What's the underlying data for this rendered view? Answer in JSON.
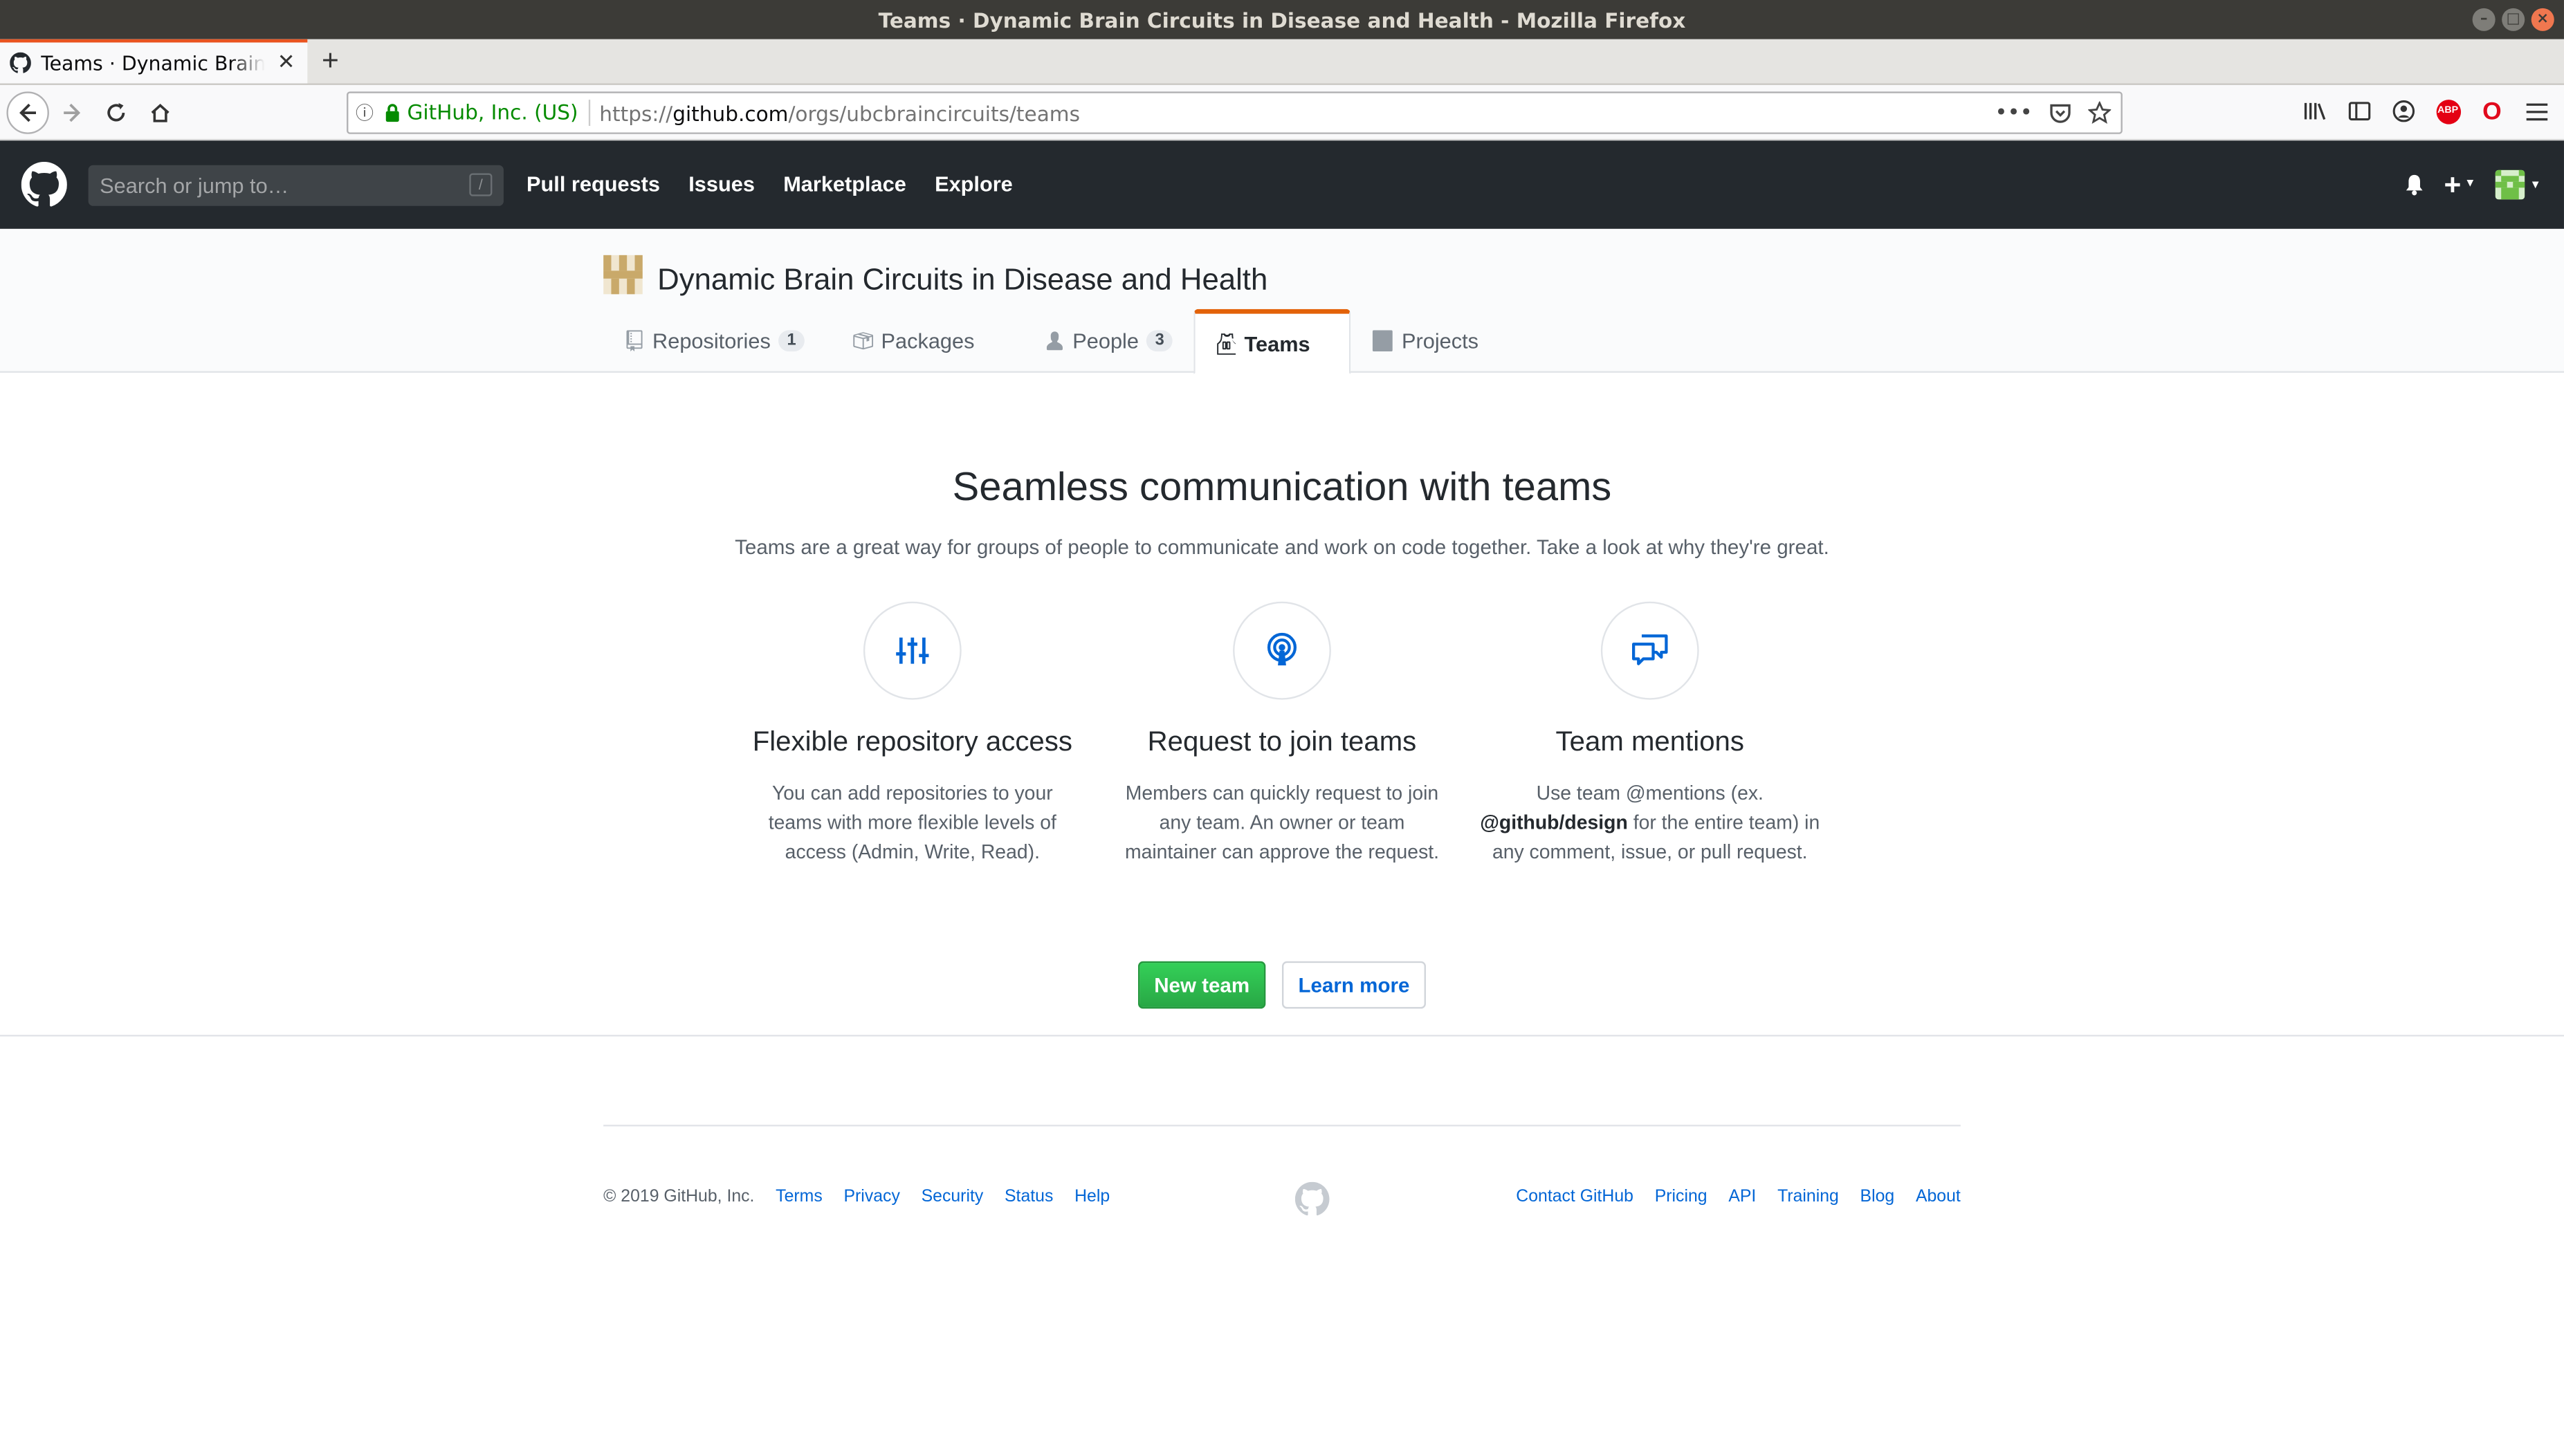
{
  "window": {
    "title": "Teams · Dynamic Brain Circuits in Disease and Health - Mozilla Firefox"
  },
  "browser": {
    "tab_title": "Teams · Dynamic Brain Circuits in Disease and Health",
    "tab_close": "✕",
    "new_tab": "+",
    "url_org": "GitHub, Inc. (US)",
    "url_scheme": "https://",
    "url_host": "github.com",
    "url_path": "/orgs/ubcbraincircuits/teams",
    "abp_label": "ABP"
  },
  "gh_header": {
    "search_placeholder": "Search or jump to…",
    "slash_key": "/",
    "nav": [
      "Pull requests",
      "Issues",
      "Marketplace",
      "Explore"
    ],
    "plus": "+"
  },
  "org": {
    "name": "Dynamic Brain Circuits in Disease and Health",
    "tabs": [
      {
        "label": "Repositories",
        "count": "1",
        "icon": "repo-icon"
      },
      {
        "label": "Packages",
        "icon": "package-icon"
      },
      {
        "label": "People",
        "count": "3",
        "icon": "person-icon"
      },
      {
        "label": "Teams",
        "icon": "jersey-icon",
        "selected": true
      },
      {
        "label": "Projects",
        "icon": "project-icon"
      }
    ]
  },
  "blankslate": {
    "title": "Seamless communication with teams",
    "subtitle": "Teams are a great way for groups of people to communicate and work on code together. Take a look at why they're great.",
    "features": [
      {
        "icon": "settings-sliders-icon",
        "title": "Flexible repository access",
        "desc": "You can add repositories to your teams with more flexible levels of access (Admin, Write, Read)."
      },
      {
        "icon": "broadcast-icon",
        "title": "Request to join teams",
        "desc": "Members can quickly request to join any team. An owner or team maintainer can approve the request."
      },
      {
        "icon": "comment-discussion-icon",
        "title": "Team mentions",
        "desc_pre": "Use team @mentions (ex.",
        "desc_bold": "@github/design",
        "desc_post": "for the entire team) in any comment, issue, or pull request."
      }
    ],
    "new_team_button": "New team",
    "learn_more_button": "Learn more"
  },
  "footer": {
    "copyright": "© 2019 GitHub, Inc.",
    "left_links": [
      "Terms",
      "Privacy",
      "Security",
      "Status",
      "Help"
    ],
    "right_links": [
      "Contact GitHub",
      "Pricing",
      "API",
      "Training",
      "Blog",
      "About"
    ]
  },
  "colors": {
    "header_bg": "#24292e",
    "accent_orange": "#e36209",
    "primary_green": "#28a745",
    "link_blue": "#0366d6"
  }
}
